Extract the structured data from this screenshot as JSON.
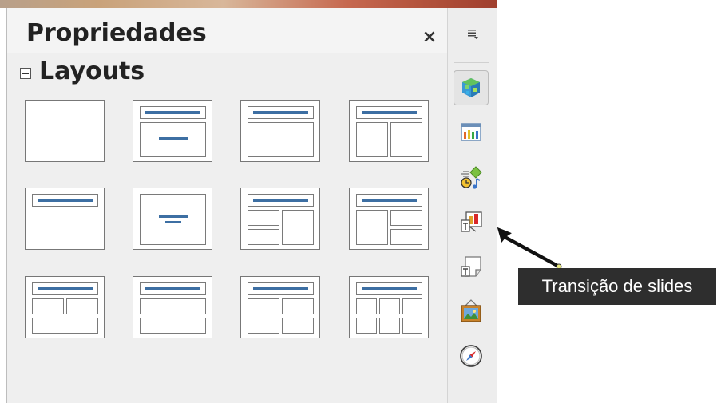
{
  "panel": {
    "title": "Propriedades",
    "close_symbol": "×"
  },
  "layouts_section": {
    "title": "Layouts",
    "collapse_state": "expanded",
    "items": [
      {
        "id": "blank"
      },
      {
        "id": "title-content"
      },
      {
        "id": "title-content-box"
      },
      {
        "id": "title-2-content"
      },
      {
        "id": "title-only"
      },
      {
        "id": "centered-text"
      },
      {
        "id": "title-2-content-and-content"
      },
      {
        "id": "title-content-and-2-content"
      },
      {
        "id": "title-2-content-over-content"
      },
      {
        "id": "title-content-over-content"
      },
      {
        "id": "title-4-content"
      },
      {
        "id": "title-6-content"
      }
    ]
  },
  "tabbar": {
    "menu_icon": "sidebar-menu-icon",
    "tabs": [
      {
        "icon": "properties-icon",
        "active": true
      },
      {
        "icon": "master-slides-icon",
        "active": false
      },
      {
        "icon": "custom-animation-icon",
        "active": false
      },
      {
        "icon": "slide-transition-icon",
        "active": false
      },
      {
        "icon": "styles-and-formatting-icon",
        "active": false
      },
      {
        "icon": "gallery-icon",
        "active": false
      },
      {
        "icon": "navigator-icon",
        "active": false
      }
    ]
  },
  "tooltip": {
    "text": "Transição de slides"
  },
  "colors": {
    "accent_bar": "#3d6fa3",
    "tooltip_bg": "#2e2e2e"
  }
}
